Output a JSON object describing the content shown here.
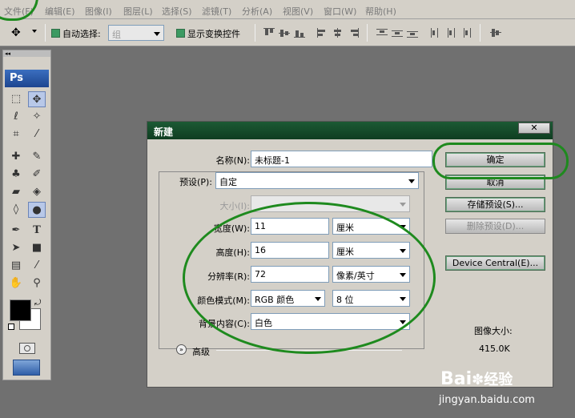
{
  "menubar": {
    "items": [
      "文件(F)",
      "编辑(E)",
      "图像(I)",
      "图层(L)",
      "选择(S)",
      "滤镜(T)",
      "分析(A)",
      "视图(V)",
      "窗口(W)",
      "帮助(H)"
    ]
  },
  "options_bar": {
    "auto_select_label": "自动选择:",
    "auto_select_value": "组",
    "show_transform_label": "显示变换控件"
  },
  "toolbox": {
    "logo": "Ps",
    "type_tool_glyph": "T"
  },
  "dialog": {
    "title": "新建",
    "name_label": "名称(N):",
    "name_value": "未标题-1",
    "preset_label": "预设(P):",
    "preset_value": "自定",
    "size_label": "大小(I):",
    "width_label": "宽度(W):",
    "width_value": "11",
    "width_unit": "厘米",
    "height_label": "高度(H):",
    "height_value": "16",
    "height_unit": "厘米",
    "resolution_label": "分辨率(R):",
    "resolution_value": "72",
    "resolution_unit": "像素/英寸",
    "color_mode_label": "颜色模式(M):",
    "color_mode_value": "RGB 颜色",
    "bit_depth_value": "8 位",
    "background_label": "背景内容(C):",
    "background_value": "白色",
    "advanced_label": "高级",
    "ok_button": "确定",
    "cancel_button": "取消",
    "save_preset_button": "存储预设(S)...",
    "delete_preset_button": "删除预设(D)...",
    "device_central_button": "Device Central(E)...",
    "image_size_label": "图像大小:",
    "image_size_value": "415.0K"
  },
  "watermark": {
    "brand": "Bai",
    "brand_suffix": "经验",
    "url": "jingyan.baidu.com"
  },
  "colors": {
    "title_bar": "#0f3d21",
    "annotation_green": "#1e8a1e",
    "background": "#707070"
  }
}
